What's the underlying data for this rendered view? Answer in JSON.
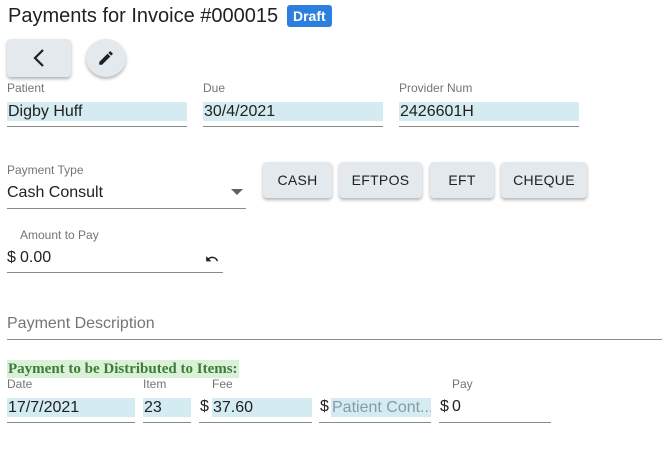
{
  "header": {
    "title": "Payments for Invoice #000015",
    "status_badge": "Draft"
  },
  "toolbar": {
    "back_icon": "chevron-left-icon",
    "edit_icon": "pencil-icon"
  },
  "invoice_fields": {
    "patient": {
      "label": "Patient",
      "value": "Digby Huff"
    },
    "due": {
      "label": "Due",
      "value": "30/4/2021"
    },
    "provider_num": {
      "label": "Provider Num",
      "value": "2426601H"
    }
  },
  "payment": {
    "type_label": "Payment Type",
    "type_value": "Cash Consult",
    "method_buttons": [
      "CASH",
      "EFTPOS",
      "EFT",
      "CHEQUE"
    ],
    "amount_label": "Amount to Pay",
    "amount_prefix": "$",
    "amount_value": "0.00",
    "description_placeholder": "Payment Description"
  },
  "distribution": {
    "heading": "Payment to be Distributed to Items:",
    "columns": {
      "date": "Date",
      "item": "Item",
      "fee": "Fee",
      "pay": "Pay"
    },
    "rows": [
      {
        "date": "17/7/2021",
        "item": "23",
        "fee_prefix": "$",
        "fee": "37.60",
        "contrib_prefix": "$",
        "contrib_placeholder": "Patient Cont...",
        "pay_prefix": "$",
        "pay": "0"
      }
    ]
  },
  "colors": {
    "badge": "#2d7fdd",
    "field_highlight": "#d3ebf1",
    "heading_highlight": "#d9f1d6",
    "button_bg": "#e3e9ed"
  }
}
